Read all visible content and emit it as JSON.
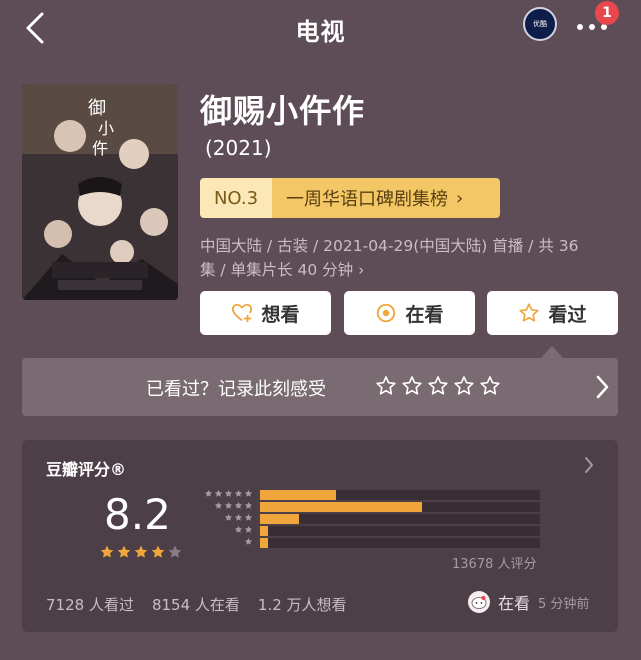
{
  "header": {
    "title": "电视",
    "avatar_text": "优酷",
    "badge_count": "1"
  },
  "show": {
    "title": "御赐小仵作",
    "year": "(2021)",
    "rank": {
      "no": "NO.3",
      "label": "一周华语口碑剧集榜",
      "chevron": "›"
    },
    "meta_line1": "中国大陆 / 古装 / 2021-04-29(中国大陆) 首播 / 共 36",
    "meta_line2": "集 / 单集片长 40 分钟 ›"
  },
  "actions": {
    "want": "想看",
    "watching": "在看",
    "watched": "看过"
  },
  "review": {
    "prompt": "已看过？记录此刻感受"
  },
  "rating": {
    "header": "豆瓣评分®",
    "score": "8.2",
    "score_stars": 4,
    "raters": "13678 人评分",
    "distribution": [
      {
        "stars": 5,
        "fraction": 0.27
      },
      {
        "stars": 4,
        "fraction": 0.58
      },
      {
        "stars": 3,
        "fraction": 0.14
      },
      {
        "stars": 2,
        "fraction": 0.03
      },
      {
        "stars": 1,
        "fraction": 0.03
      }
    ]
  },
  "stats": {
    "watched": "7128 人看过",
    "watching": "8154 人在看",
    "want": "1.2 万人想看"
  },
  "friend": {
    "status": "在看",
    "time": "5 分钟前"
  },
  "colors": {
    "background": "#5e4d56",
    "card": "#4d3f47",
    "accent": "#f0a63a",
    "rank_bg": "#f4c766",
    "badge": "#e8474c"
  },
  "icons": {
    "back": "chevron-left-icon",
    "more": "more-dots-icon",
    "want": "heart-plus-icon",
    "watching": "target-circle-icon",
    "watched": "star-outline-icon"
  }
}
